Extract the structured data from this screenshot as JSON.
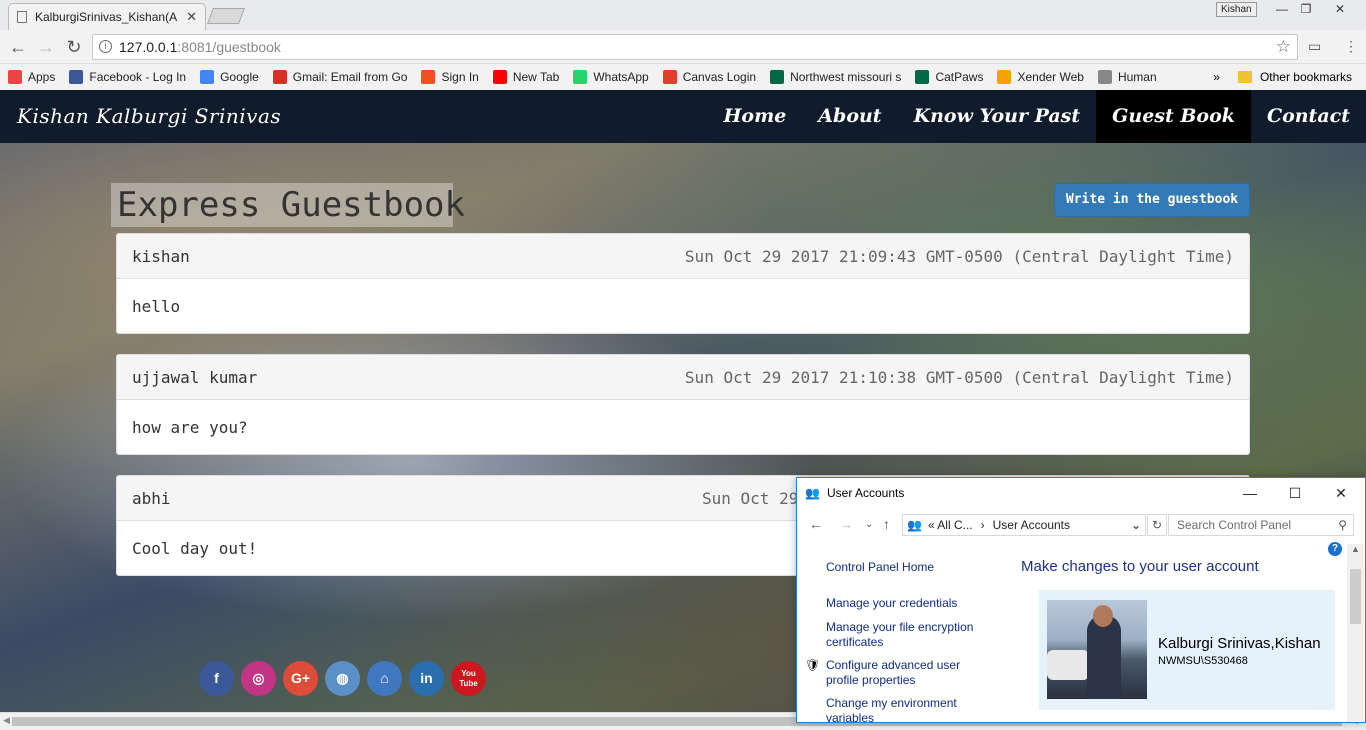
{
  "browser": {
    "tab_title": "KalburgiSrinivas_Kishan(A",
    "profile_name": "Kishan",
    "url_host": "127.0.0.1",
    "url_rest": ":8081/guestbook",
    "bookmarks": [
      {
        "label": "Apps",
        "icon": "apps-grid-icon",
        "color": "#e44"
      },
      {
        "label": "Facebook - Log In",
        "icon": "facebook-icon",
        "color": "#3b5998"
      },
      {
        "label": "Google",
        "icon": "google-icon",
        "color": "#4285f4"
      },
      {
        "label": "Gmail: Email from Go",
        "icon": "gmail-icon",
        "color": "#d93025"
      },
      {
        "label": "Sign In",
        "icon": "microsoft-icon",
        "color": "#f25022"
      },
      {
        "label": "New Tab",
        "icon": "youtube-icon",
        "color": "#ff0000"
      },
      {
        "label": "WhatsApp",
        "icon": "whatsapp-icon",
        "color": "#25d366"
      },
      {
        "label": "Canvas Login",
        "icon": "canvas-icon",
        "color": "#e13f2b"
      },
      {
        "label": "Northwest missouri s",
        "icon": "northwest-icon",
        "color": "#006747"
      },
      {
        "label": "CatPaws",
        "icon": "catpaws-icon",
        "color": "#006747"
      },
      {
        "label": "Xender Web",
        "icon": "xender-icon",
        "color": "#f4a300"
      },
      {
        "label": "Human",
        "icon": "page-icon",
        "color": "#888888"
      }
    ],
    "more_bookmarks": "»",
    "other_bookmarks": "Other bookmarks"
  },
  "site": {
    "brand": "Kishan Kalburgi Srinivas",
    "nav": [
      "Home",
      "About",
      "Know Your Past",
      "Guest Book",
      "Contact"
    ],
    "active_nav": "Guest Book",
    "heading": "Express Guestbook",
    "write_button": "Write in the guestbook",
    "entries": [
      {
        "author": "kishan",
        "date": "Sun Oct 29 2017 21:09:43 GMT-0500 (Central Daylight Time)",
        "message": "hello"
      },
      {
        "author": "ujjawal kumar",
        "date": "Sun Oct 29 2017 21:10:38 GMT-0500 (Central Daylight Time)",
        "message": "how are you?"
      },
      {
        "author": "abhi",
        "date": "Sun Oct 29",
        "message": "Cool day out!"
      }
    ],
    "socials": [
      {
        "name": "facebook",
        "glyph": "f",
        "color": "#3b5998"
      },
      {
        "name": "instagram",
        "glyph": "◎",
        "color": "#c13584"
      },
      {
        "name": "google-plus",
        "glyph": "G+",
        "color": "#dd4b39"
      },
      {
        "name": "bitbucket",
        "glyph": "◍",
        "color": "#5b8fc7"
      },
      {
        "name": "github",
        "glyph": "⌂",
        "color": "#4078c0"
      },
      {
        "name": "linkedin",
        "glyph": "in",
        "color": "#2a6eb0"
      },
      {
        "name": "youtube",
        "glyph": "You Tube",
        "color": "#cc181e"
      }
    ]
  },
  "user_accounts": {
    "title": "User Accounts",
    "breadcrumb_prefix": "«  All C...",
    "breadcrumb_current": "User Accounts",
    "search_placeholder": "Search Control Panel",
    "left_links": [
      "Control Panel Home",
      "Manage your credentials",
      "Manage your file encryption certificates",
      "Configure advanced user profile properties",
      "Change my environment variables"
    ],
    "main_title": "Make changes to your user account",
    "user_name": "Kalburgi Srinivas,Kishan",
    "user_domain": "NWMSU\\S530468"
  }
}
